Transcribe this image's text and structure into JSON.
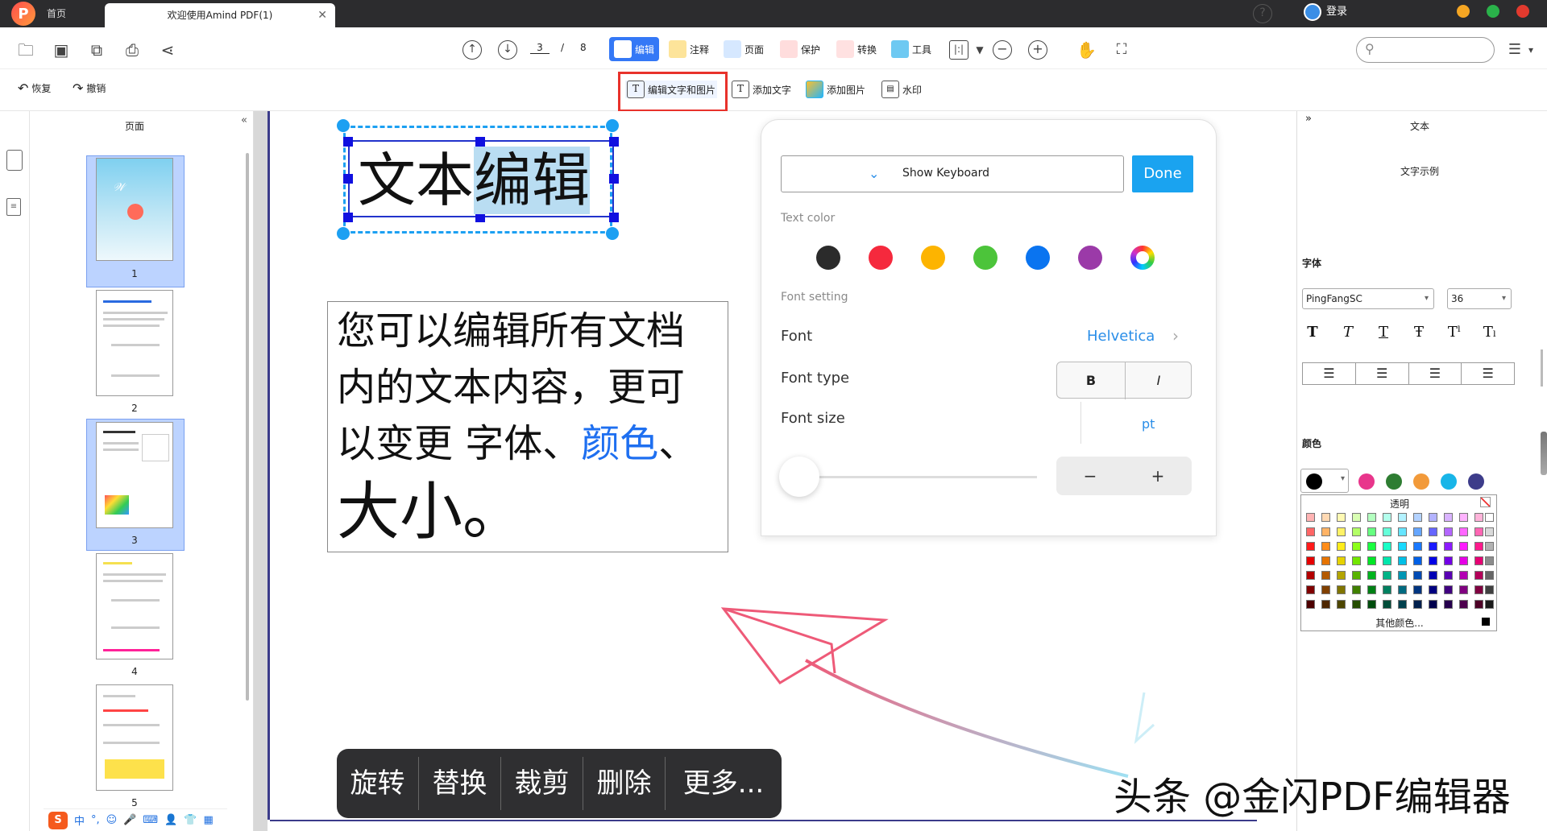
{
  "titlebar": {
    "app_logo": "P",
    "tab_home": "首页",
    "tab_doc": "欢迎使用Amind PDF(1)",
    "tab_close": "✕",
    "help": "?",
    "login": "登录",
    "window_dots": [
      "#f5a623",
      "#2ab24a",
      "#e23a2e"
    ]
  },
  "toolbar": {
    "page_current": "3",
    "page_sep": "/",
    "page_total": "8",
    "modes": [
      {
        "label": "编辑",
        "icon": "edit-icon",
        "active": true
      },
      {
        "label": "注释",
        "icon": "annotate-icon"
      },
      {
        "label": "页面",
        "icon": "page-icon"
      },
      {
        "label": "保护",
        "icon": "protect-icon"
      },
      {
        "label": "转换",
        "icon": "convert-icon"
      },
      {
        "label": "工具",
        "icon": "tools-icon"
      }
    ],
    "search_placeholder": ""
  },
  "subtoolbar": {
    "undo": "恢复",
    "redo": "撤销",
    "edit_text_image": "编辑文字和图片",
    "add_text": "添加文字",
    "add_image": "添加图片",
    "watermark": "水印"
  },
  "thumbpanel": {
    "title": "页面",
    "collapse": "«",
    "pages": [
      "1",
      "2",
      "3",
      "4",
      "5"
    ]
  },
  "ime": {
    "items": [
      "中",
      "°,",
      "☺",
      "🎤",
      "⌨",
      "👤",
      "👕",
      "▦"
    ]
  },
  "document": {
    "title_plain": "文本",
    "title_highlight": "编辑",
    "para_line1": "您可以编辑所有文档",
    "para_line2": "内的文本内容，更可",
    "para_line3a": "以变更 字体、",
    "para_line3b": "颜色",
    "para_line3c": "、",
    "para_line4": "大小。"
  },
  "popup": {
    "show_keyboard": "Show Keyboard",
    "done": "Done",
    "text_color": "Text color",
    "colors": [
      "#2b2b2b",
      "#f5293d",
      "#fdb400",
      "#4cc43a",
      "#0a74f0",
      "#9b3aa8"
    ],
    "font_setting": "Font setting",
    "font": "Font",
    "font_value": "Helvetica",
    "font_type": "Font type",
    "bold": "B",
    "italic": "I",
    "font_size": "Font size",
    "pt": "pt",
    "minus": "−",
    "plus": "+"
  },
  "rightpanel": {
    "expand": "»",
    "title": "文本",
    "sample": "文字示例",
    "font_label": "字体",
    "font_family": "PingFangSC",
    "font_size": "36",
    "format": [
      "T",
      "T",
      "T",
      "Ŧ",
      "Tˡ",
      "Tₗ"
    ],
    "color_label": "颜色",
    "quick_colors": [
      "#e8358b",
      "#2e7d32",
      "#f29a3a",
      "#18b5e8",
      "#3d3c8a"
    ],
    "transparent": "透明",
    "more_colors": "其他颜色..."
  },
  "ctxmenu": {
    "items": [
      "旋转",
      "替换",
      "裁剪",
      "删除",
      "更多..."
    ]
  },
  "watermark": "头条 @金闪PDF编辑器"
}
